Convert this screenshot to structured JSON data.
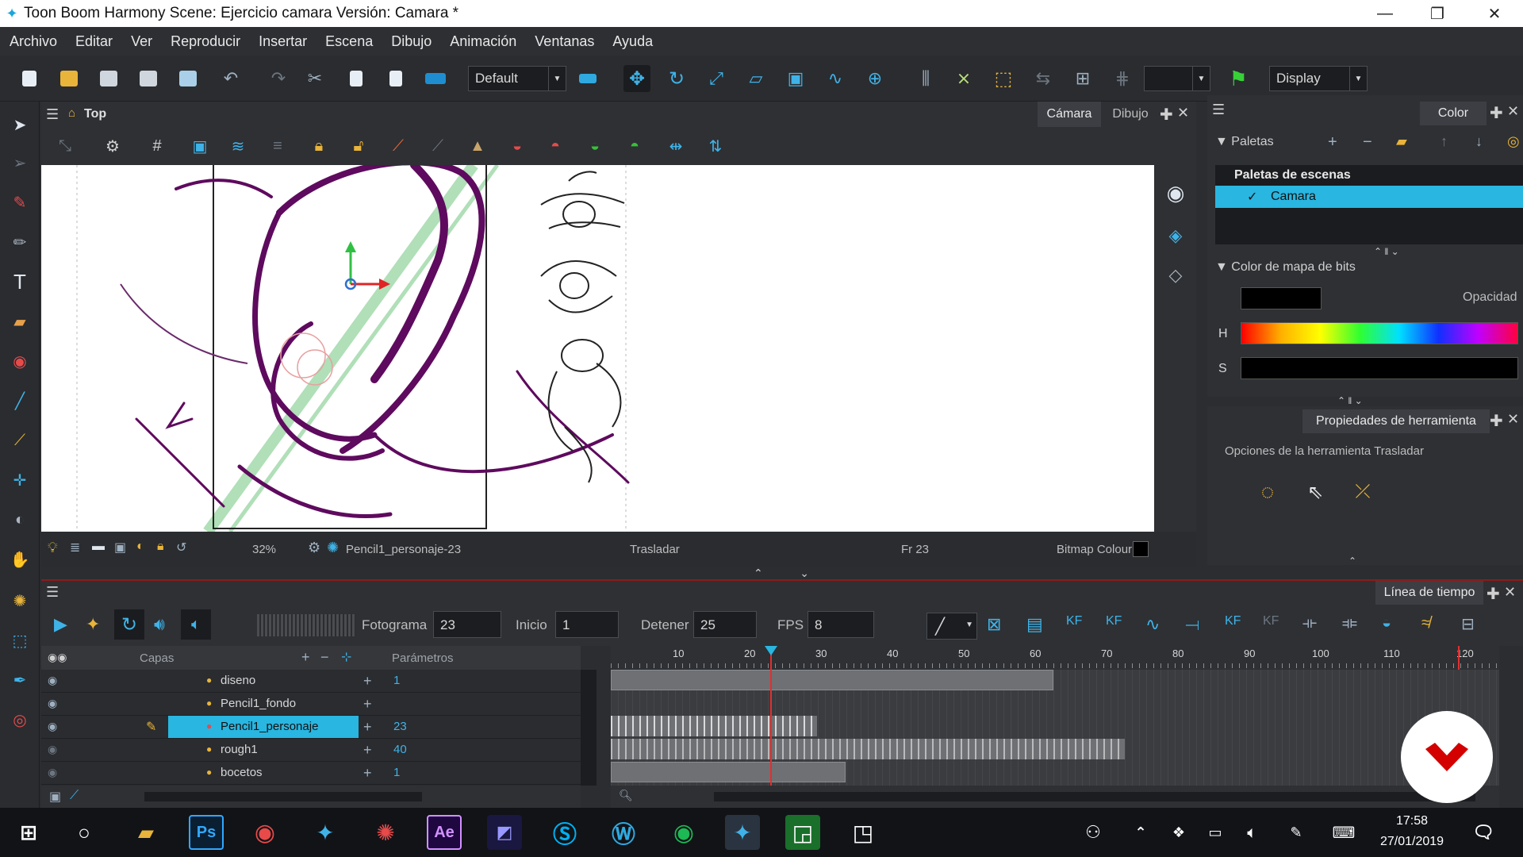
{
  "window": {
    "title": "Toon Boom Harmony Scene: Ejercicio camara Versión: Camara *"
  },
  "menu": [
    "Archivo",
    "Editar",
    "Ver",
    "Reproducir",
    "Insertar",
    "Escena",
    "Dibujo",
    "Animación",
    "Ventanas",
    "Ayuda"
  ],
  "toolbar": {
    "workspace_select": "Default",
    "display_select": "Display"
  },
  "view": {
    "title": "Top",
    "tabs": [
      "Cámara",
      "Dibujo"
    ],
    "status": {
      "zoom": "32%",
      "drawing": "Pencil1_personaje-23",
      "tool": "Trasladar",
      "frame": "Fr 23",
      "bitmap": "Bitmap Colour"
    }
  },
  "color_panel": {
    "tab": "Color",
    "palettes_label": "Paletas",
    "scene_palettes": "Paletas de escenas",
    "palette_item": "Camara",
    "bitmap_color": "Color de mapa de bits",
    "opacity": "Opacidad",
    "h": "H",
    "s": "S"
  },
  "tool_properties": {
    "tab": "Propiedades de herramienta",
    "options": "Opciones de la herramienta Trasladar"
  },
  "timeline": {
    "tab": "Línea de tiempo",
    "frame_label": "Fotograma",
    "frame_value": "23",
    "start_label": "Inicio",
    "start_value": "1",
    "stop_label": "Detener",
    "stop_value": "25",
    "fps_label": "FPS",
    "fps_value": "8",
    "layers_header": "Capas",
    "params_header": "Parámetros",
    "ruler": [
      "10",
      "20",
      "30",
      "40",
      "50",
      "60",
      "70",
      "80",
      "90",
      "100",
      "110",
      "120"
    ],
    "layers": [
      {
        "name": "diseno",
        "value": "1"
      },
      {
        "name": "Pencil1_fondo",
        "value": ""
      },
      {
        "name": "Pencil1_personaje",
        "value": "23"
      },
      {
        "name": "rough1",
        "value": "40"
      },
      {
        "name": "bocetos",
        "value": "1"
      }
    ]
  },
  "taskbar": {
    "time": "17:58",
    "date": "27/01/2019"
  },
  "colors": {
    "accent": "#29b6e0",
    "playhead": "#e03030",
    "stroke": "#5e0a5e"
  }
}
